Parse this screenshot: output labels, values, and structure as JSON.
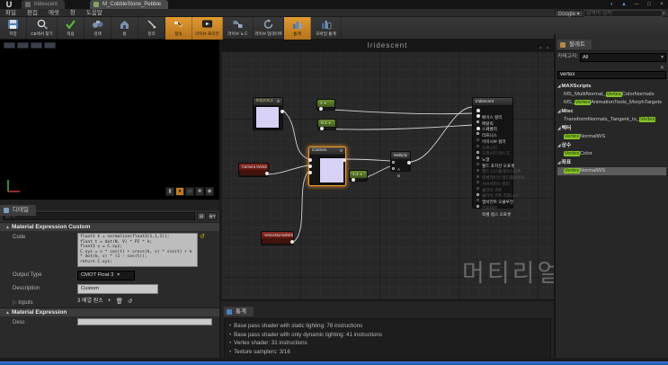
{
  "titlebar": {
    "logo": "U",
    "tabs": [
      {
        "label": "Iridescent"
      },
      {
        "label": "M_CobbleStone_Pebble"
      }
    ],
    "window_buttons": {
      "feedback": "◖",
      "up": "▲",
      "minimize": "─",
      "maximize": "□",
      "close": "×"
    }
  },
  "menubar": {
    "items": [
      "파일",
      "편집",
      "에셋",
      "창",
      "도움말"
    ],
    "search": {
      "engine": "Google",
      "caret": "▾",
      "placeholder": "검색어 입력",
      "magnifier": "⌕"
    }
  },
  "toolbar": {
    "buttons": [
      {
        "label": "저장"
      },
      {
        "label": "CB에서 찾기"
      },
      {
        "label": "적용"
      },
      {
        "label": "검색"
      },
      {
        "label": "홈"
      },
      {
        "label": "정리"
      },
      {
        "label": "접속"
      },
      {
        "label": "라이브 프리뷰"
      },
      {
        "label": "라이브 노드"
      },
      {
        "label": "라이브 업데이트"
      },
      {
        "label": "통계"
      },
      {
        "label": "모바일 통계"
      }
    ]
  },
  "details": {
    "tab": "디테일",
    "search_placeholder": "검색",
    "section_custom": "Material Expression Custom",
    "rows": {
      "code_label": "Code",
      "code_lines": [
        "float3 k = normalize(float3(1,1,1));",
        "float t = dot(N, V) * PI * k;",
        "float3 v = C.xyz;",
        "C.xyz = v * cos(t) + cross(k, v) * sin(t) + k * dot(k, v) * (1 - cos(t));",
        "return C.xyz;"
      ],
      "output_type_label": "Output Type",
      "output_type_value": "CMOT Float 3",
      "description_label": "Description",
      "description_value": "Custom",
      "inputs_label": "Inputs",
      "inputs_value": "3 배열 원소"
    },
    "section_expression": "Material Expression",
    "desc_label": "Desc"
  },
  "graph": {
    "title": "Iridescent",
    "watermark": "머티리얼",
    "nodes": {
      "color_constant": {
        "title": "0.8,0.8,1"
      },
      "const_metallic": {
        "title": "1"
      },
      "const_roughness": {
        "title": "0.1"
      },
      "const_b": {
        "title": "1.1"
      },
      "custom": {
        "title": "Custom"
      },
      "camera_vector": {
        "title": "Camera Vector"
      },
      "vertex_normal": {
        "title": "VertexNormalWS"
      },
      "multiply": {
        "title": "Multiply",
        "pins": [
          "A",
          "B"
        ]
      },
      "main": {
        "title": "Iridescent",
        "pins": [
          {
            "label": "베이스 컬러"
          },
          {
            "label": "메탈릭"
          },
          {
            "label": "스페큘러"
          },
          {
            "label": "러프니스"
          },
          {
            "label": "이미시브 컬러"
          },
          {
            "label": "오파시티"
          },
          {
            "label": "오파시티 마스크"
          },
          {
            "label": "노멀"
          },
          {
            "label": "월드 포지션 오프셋"
          },
          {
            "label": "월드 디스플레이스먼트"
          },
          {
            "label": "테셀레이션 멀티플라이어"
          },
          {
            "label": "서브서피스 컬러"
          },
          {
            "label": "클리어 코트"
          },
          {
            "label": "클리어 코트 러프니스"
          },
          {
            "label": "앰비언트 오클루전"
          },
          {
            "label": "리프랙션"
          },
          {
            "label": "픽셀 뎁스 오프셋"
          }
        ]
      }
    }
  },
  "stats": {
    "tab": "통계",
    "lines": [
      "Base pass shader with static lighting: 78 instructions",
      "Base pass shader with only dynamic lighting: 41 instructions",
      "Vertex shader: 31 instructions",
      "Texture samplers: 3/16"
    ]
  },
  "palette": {
    "tab": "팔레트",
    "category_label": "카테고리:",
    "category_value": "All",
    "search_value": "vertex",
    "items": [
      {
        "type": "cat",
        "label": "MAXScripts"
      },
      {
        "type": "item",
        "prefix": "MS_MultiNormal_",
        "match": "Vertex",
        "suffix": "ColorNormals"
      },
      {
        "type": "item",
        "prefix": "MS_",
        "match": "Vertex",
        "suffix": "AnimationTools_MorphTargets"
      },
      {
        "type": "cat",
        "label": "Misc"
      },
      {
        "type": "item",
        "prefix": "TransformNormals_Tangent_to_",
        "match": "Vertex",
        "suffix": ""
      },
      {
        "type": "cat",
        "label": "벡터"
      },
      {
        "type": "item",
        "prefix": "",
        "match": "Vertex",
        "suffix": "NormalWS"
      },
      {
        "type": "cat",
        "label": "상수"
      },
      {
        "type": "item",
        "prefix": "",
        "match": "Vertex",
        "suffix": "Color"
      },
      {
        "type": "cat",
        "label": "좌표"
      },
      {
        "type": "item",
        "prefix": "",
        "match": "Vertex",
        "suffix": "NormalWS",
        "selected": true
      }
    ]
  },
  "colors": {
    "accent_orange": "#d08a28",
    "node_selection": "#ef9c30",
    "highlight_green": "#86c226",
    "taskbar_blue": "#2a62c6"
  }
}
